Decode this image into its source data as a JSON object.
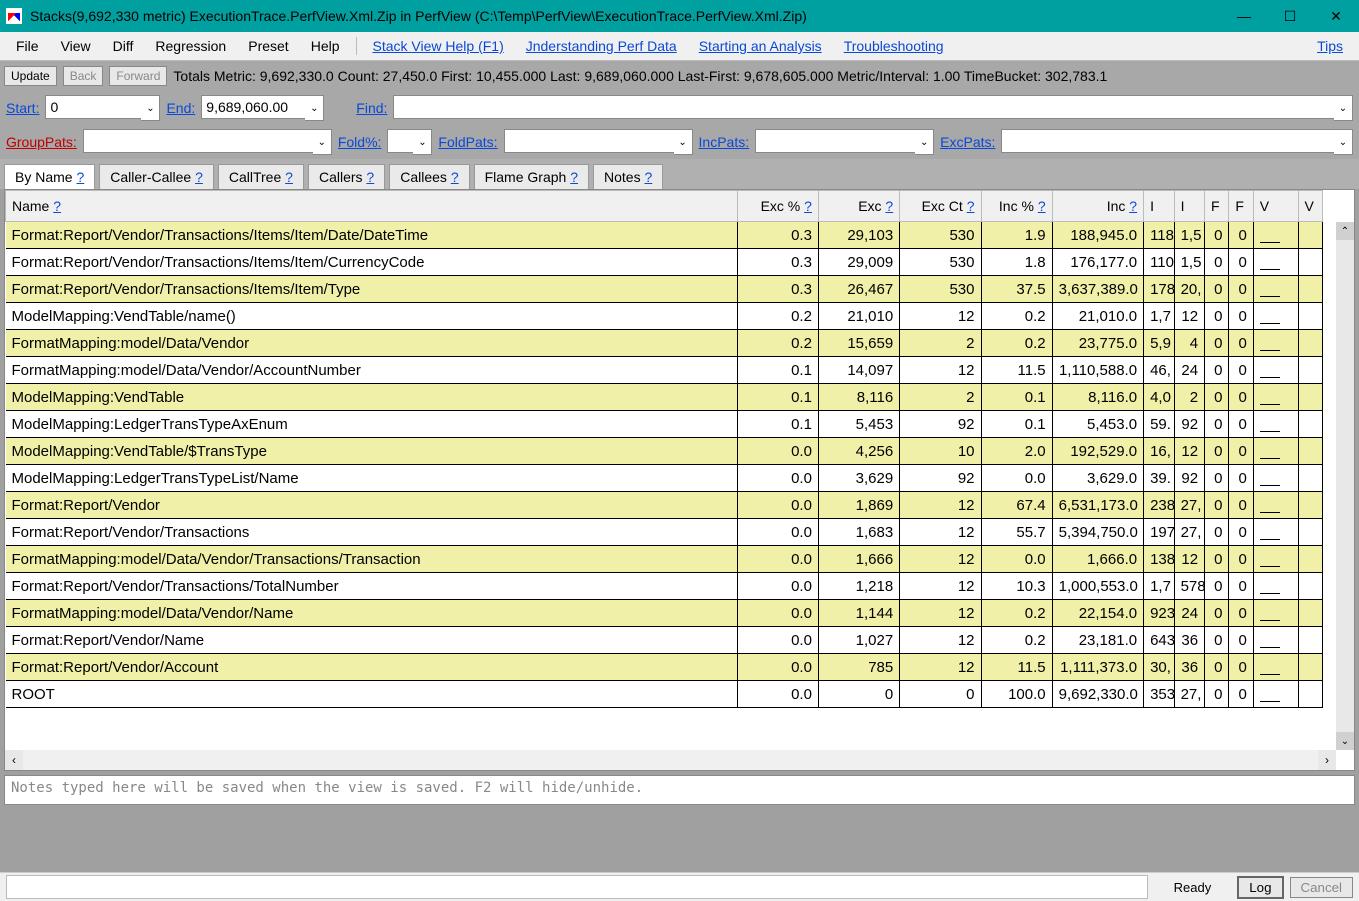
{
  "window": {
    "title": "Stacks(9,692,330 metric) ExecutionTrace.PerfView.Xml.Zip in PerfView (C:\\Temp\\PerfView\\ExecutionTrace.PerfView.Xml.Zip)"
  },
  "menu": {
    "file": "File",
    "view": "View",
    "diff": "Diff",
    "regression": "Regression",
    "preset": "Preset",
    "help": "Help",
    "stack_help": "Stack View Help (F1)",
    "understanding": "Jnderstanding Perf Data",
    "starting": "Starting an Analysis",
    "troubleshooting": "Troubleshooting",
    "tips": "Tips"
  },
  "toolbar": {
    "update": "Update",
    "back": "Back",
    "forward": "Forward",
    "stats": "Totals Metric: 9,692,330.0   Count: 27,450.0   First: 10,455.000  Last: 9,689,060.000   Last-First: 9,678,605.000   Metric/Interval: 1.00   TimeBucket: 302,783.1"
  },
  "filters1": {
    "start_lbl": "Start:",
    "start_val": "0",
    "end_lbl": "End:",
    "end_val": "9,689,060.00",
    "find_lbl": "Find:",
    "find_val": ""
  },
  "filters2": {
    "grouppats_lbl": "GroupPats:",
    "foldpct_lbl": "Fold%:",
    "foldpats_lbl": "FoldPats:",
    "incpats_lbl": "IncPats:",
    "excpats_lbl": "ExcPats:"
  },
  "tabs": {
    "byname": "By Name ",
    "callercallee": "Caller-Callee ",
    "calltree": "CallTree ",
    "callers": "Callers ",
    "callees": "Callees ",
    "flamegraph": "Flame Graph ",
    "notes": "Notes ",
    "q": "?"
  },
  "columns": {
    "name": "Name ",
    "excpct": "Exc % ",
    "exc": "Exc ",
    "excct": "Exc Ct ",
    "incpct": "Inc % ",
    "inc": "Inc ",
    "i1": "I",
    "i2": "I",
    "f1": "F",
    "f2": "F",
    "v1": "V",
    "v2": "V",
    "q": "?"
  },
  "rows": [
    {
      "alt": true,
      "name": "Format:Report/Vendor/Transactions/Items/Item/Date/DateTime",
      "excpct": "0.3",
      "exc": "29,103",
      "excct": "530",
      "incpct": "1.9",
      "inc": "188,945.0",
      "i1": "118",
      "i2": "1,5",
      "f1": "0",
      "f2": "0"
    },
    {
      "alt": false,
      "name": "Format:Report/Vendor/Transactions/Items/Item/CurrencyCode",
      "excpct": "0.3",
      "exc": "29,009",
      "excct": "530",
      "incpct": "1.8",
      "inc": "176,177.0",
      "i1": "110",
      "i2": "1,5",
      "f1": "0",
      "f2": "0"
    },
    {
      "alt": true,
      "name": "Format:Report/Vendor/Transactions/Items/Item/Type",
      "excpct": "0.3",
      "exc": "26,467",
      "excct": "530",
      "incpct": "37.5",
      "inc": "3,637,389.0",
      "i1": "178",
      "i2": "20,",
      "f1": "0",
      "f2": "0"
    },
    {
      "alt": false,
      "name": "ModelMapping:VendTable/name()",
      "excpct": "0.2",
      "exc": "21,010",
      "excct": "12",
      "incpct": "0.2",
      "inc": "21,010.0",
      "i1": "1,7",
      "i2": "12",
      "f1": "0",
      "f2": "0"
    },
    {
      "alt": true,
      "name": "FormatMapping:model/Data/Vendor",
      "excpct": "0.2",
      "exc": "15,659",
      "excct": "2",
      "incpct": "0.2",
      "inc": "23,775.0",
      "i1": "5,9",
      "i2": "4",
      "f1": "0",
      "f2": "0"
    },
    {
      "alt": false,
      "name": "FormatMapping:model/Data/Vendor/AccountNumber",
      "excpct": "0.1",
      "exc": "14,097",
      "excct": "12",
      "incpct": "11.5",
      "inc": "1,110,588.0",
      "i1": "46,",
      "i2": "24",
      "f1": "0",
      "f2": "0"
    },
    {
      "alt": true,
      "name": "ModelMapping:VendTable",
      "excpct": "0.1",
      "exc": "8,116",
      "excct": "2",
      "incpct": "0.1",
      "inc": "8,116.0",
      "i1": "4,0",
      "i2": "2",
      "f1": "0",
      "f2": "0"
    },
    {
      "alt": false,
      "name": "ModelMapping:LedgerTransTypeAxEnum",
      "excpct": "0.1",
      "exc": "5,453",
      "excct": "92",
      "incpct": "0.1",
      "inc": "5,453.0",
      "i1": "59.",
      "i2": "92",
      "f1": "0",
      "f2": "0"
    },
    {
      "alt": true,
      "name": "ModelMapping:VendTable/$TransType",
      "excpct": "0.0",
      "exc": "4,256",
      "excct": "10",
      "incpct": "2.0",
      "inc": "192,529.0",
      "i1": "16,",
      "i2": "12",
      "f1": "0",
      "f2": "0"
    },
    {
      "alt": false,
      "name": "ModelMapping:LedgerTransTypeList/Name",
      "excpct": "0.0",
      "exc": "3,629",
      "excct": "92",
      "incpct": "0.0",
      "inc": "3,629.0",
      "i1": "39.",
      "i2": "92",
      "f1": "0",
      "f2": "0"
    },
    {
      "alt": true,
      "name": "Format:Report/Vendor",
      "excpct": "0.0",
      "exc": "1,869",
      "excct": "12",
      "incpct": "67.4",
      "inc": "6,531,173.0",
      "i1": "238",
      "i2": "27,",
      "f1": "0",
      "f2": "0"
    },
    {
      "alt": false,
      "name": "Format:Report/Vendor/Transactions",
      "excpct": "0.0",
      "exc": "1,683",
      "excct": "12",
      "incpct": "55.7",
      "inc": "5,394,750.0",
      "i1": "197",
      "i2": "27,",
      "f1": "0",
      "f2": "0"
    },
    {
      "alt": true,
      "name": "FormatMapping:model/Data/Vendor/Transactions/Transaction",
      "excpct": "0.0",
      "exc": "1,666",
      "excct": "12",
      "incpct": "0.0",
      "inc": "1,666.0",
      "i1": "138",
      "i2": "12",
      "f1": "0",
      "f2": "0"
    },
    {
      "alt": false,
      "name": "Format:Report/Vendor/Transactions/TotalNumber",
      "excpct": "0.0",
      "exc": "1,218",
      "excct": "12",
      "incpct": "10.3",
      "inc": "1,000,553.0",
      "i1": "1,7",
      "i2": "578",
      "f1": "0",
      "f2": "0"
    },
    {
      "alt": true,
      "name": "FormatMapping:model/Data/Vendor/Name",
      "excpct": "0.0",
      "exc": "1,144",
      "excct": "12",
      "incpct": "0.2",
      "inc": "22,154.0",
      "i1": "923",
      "i2": "24",
      "f1": "0",
      "f2": "0"
    },
    {
      "alt": false,
      "name": "Format:Report/Vendor/Name",
      "excpct": "0.0",
      "exc": "1,027",
      "excct": "12",
      "incpct": "0.2",
      "inc": "23,181.0",
      "i1": "643",
      "i2": "36",
      "f1": "0",
      "f2": "0"
    },
    {
      "alt": true,
      "name": "Format:Report/Vendor/Account",
      "excpct": "0.0",
      "exc": "785",
      "excct": "12",
      "incpct": "11.5",
      "inc": "1,111,373.0",
      "i1": "30,",
      "i2": "36",
      "f1": "0",
      "f2": "0"
    },
    {
      "alt": false,
      "name": "ROOT",
      "excpct": "0.0",
      "exc": "0",
      "excct": "0",
      "incpct": "100.0",
      "inc": "9,692,330.0",
      "i1": "353",
      "i2": "27,",
      "f1": "0",
      "f2": "0"
    }
  ],
  "notes": {
    "placeholder": "Notes typed here will be saved when the view is saved. F2 will hide/unhide."
  },
  "statusbar": {
    "ready": "Ready",
    "log": "Log",
    "cancel": "Cancel"
  }
}
